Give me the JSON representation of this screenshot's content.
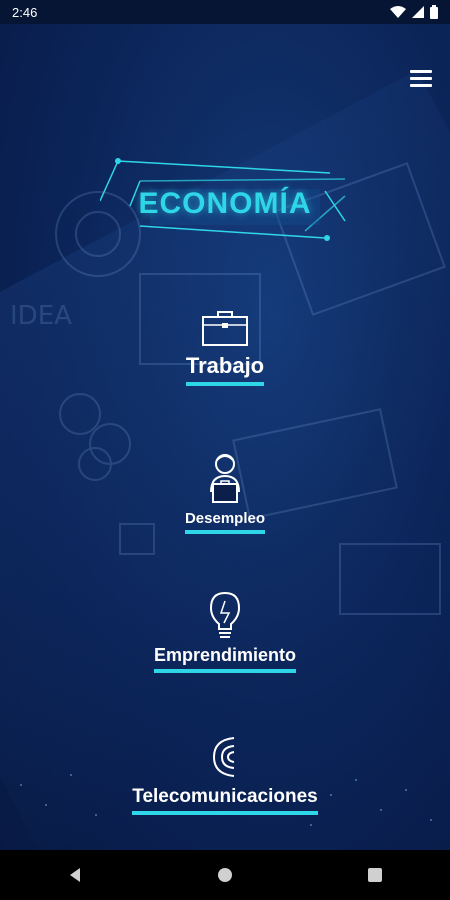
{
  "status_bar": {
    "time": "2:46"
  },
  "header": {
    "title": "ECONOMÍA"
  },
  "menu": {
    "items": [
      {
        "label": "Trabajo",
        "icon": "briefcase-icon"
      },
      {
        "label": "Desempleo",
        "icon": "person-box-icon"
      },
      {
        "label": "Emprendimiento",
        "icon": "lightbulb-icon"
      },
      {
        "label": "Telecomunicaciones",
        "icon": "signal-icon"
      }
    ]
  },
  "colors": {
    "accent": "#2fd6e8",
    "background": "#0b1f4a"
  }
}
